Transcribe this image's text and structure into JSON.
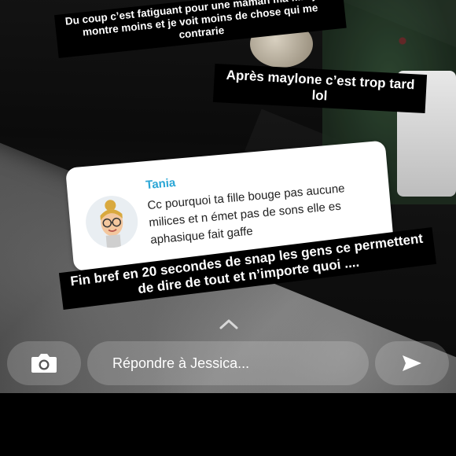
{
  "captions": {
    "top": "Du coup c’est fatiguant pour une maman ma fille je la montre moins et je voit moins de chose qui me contrarie",
    "middle": "Après maylone c’est trop tard lol",
    "bottom": "Fin bref en 20 secondes de snap les gens ce permettent de dire de tout et n’importe quoi ...."
  },
  "reply_card": {
    "name": "Tania",
    "message": "Cc pourquoi ta fille bouge pas aucune milices et n émet pas de sons elle es aphasique fait gaffe",
    "avatar_icon": "bitmoji-avatar-icon"
  },
  "bottom_bar": {
    "camera_icon": "camera-icon",
    "reply_placeholder": "Répondre à Jessica...",
    "send_icon": "send-arrow-icon"
  },
  "colors": {
    "reply_name": "#2aa6d6",
    "caption_bg": "#000000",
    "caption_text": "#ffffff"
  }
}
